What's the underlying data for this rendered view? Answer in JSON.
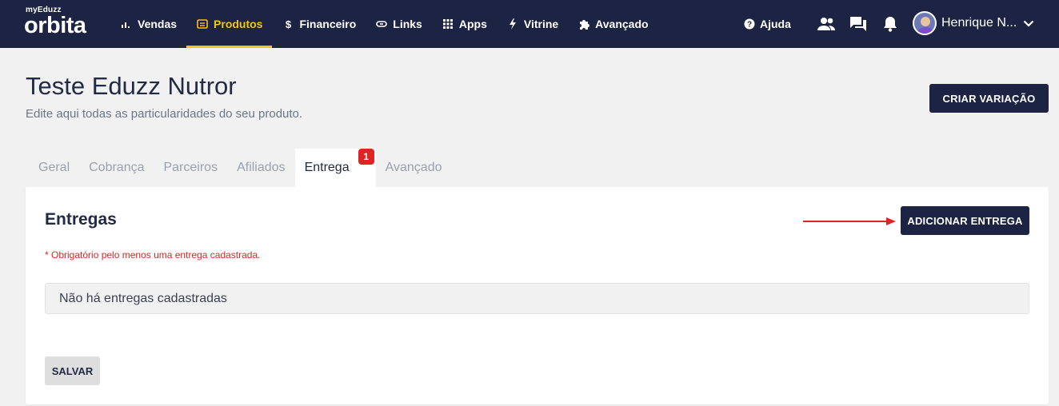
{
  "brand": {
    "small": "myEduzz",
    "big": "orbita"
  },
  "nav": {
    "items": [
      {
        "label": "Vendas",
        "icon": "bar-chart-icon",
        "active": false
      },
      {
        "label": "Produtos",
        "icon": "product-card-icon",
        "active": true
      },
      {
        "label": "Financeiro",
        "icon": "dollar-icon",
        "active": false
      },
      {
        "label": "Links",
        "icon": "link-icon",
        "active": false
      },
      {
        "label": "Apps",
        "icon": "apps-grid-icon",
        "active": false
      },
      {
        "label": "Vitrine",
        "icon": "bolt-icon",
        "active": false
      },
      {
        "label": "Avançado",
        "icon": "puzzle-icon",
        "active": false
      }
    ],
    "help_label": "Ajuda",
    "user_name": "Henrique N...",
    "accent": "#f6c318",
    "background": "#1c2343"
  },
  "page": {
    "title": "Teste Eduzz Nutror",
    "subtitle": "Edite aqui todas as particularidades do seu produto.",
    "create_variation_label": "CRIAR VARIAÇÃO"
  },
  "tabs": [
    {
      "label": "Geral",
      "active": false
    },
    {
      "label": "Cobrança",
      "active": false
    },
    {
      "label": "Parceiros",
      "active": false
    },
    {
      "label": "Afiliados",
      "active": false
    },
    {
      "label": "Entrega",
      "active": true,
      "badge": "1"
    },
    {
      "label": "Avançado",
      "active": false
    }
  ],
  "card": {
    "title": "Entregas",
    "add_label": "ADICIONAR ENTREGA",
    "required_note": "* Obrigatório pelo menos uma entrega cadastrada.",
    "empty_text": "Não há entregas cadastradas",
    "save_label": "SALVAR"
  },
  "colors": {
    "error": "#e02424",
    "primary_dark": "#1c2343"
  }
}
